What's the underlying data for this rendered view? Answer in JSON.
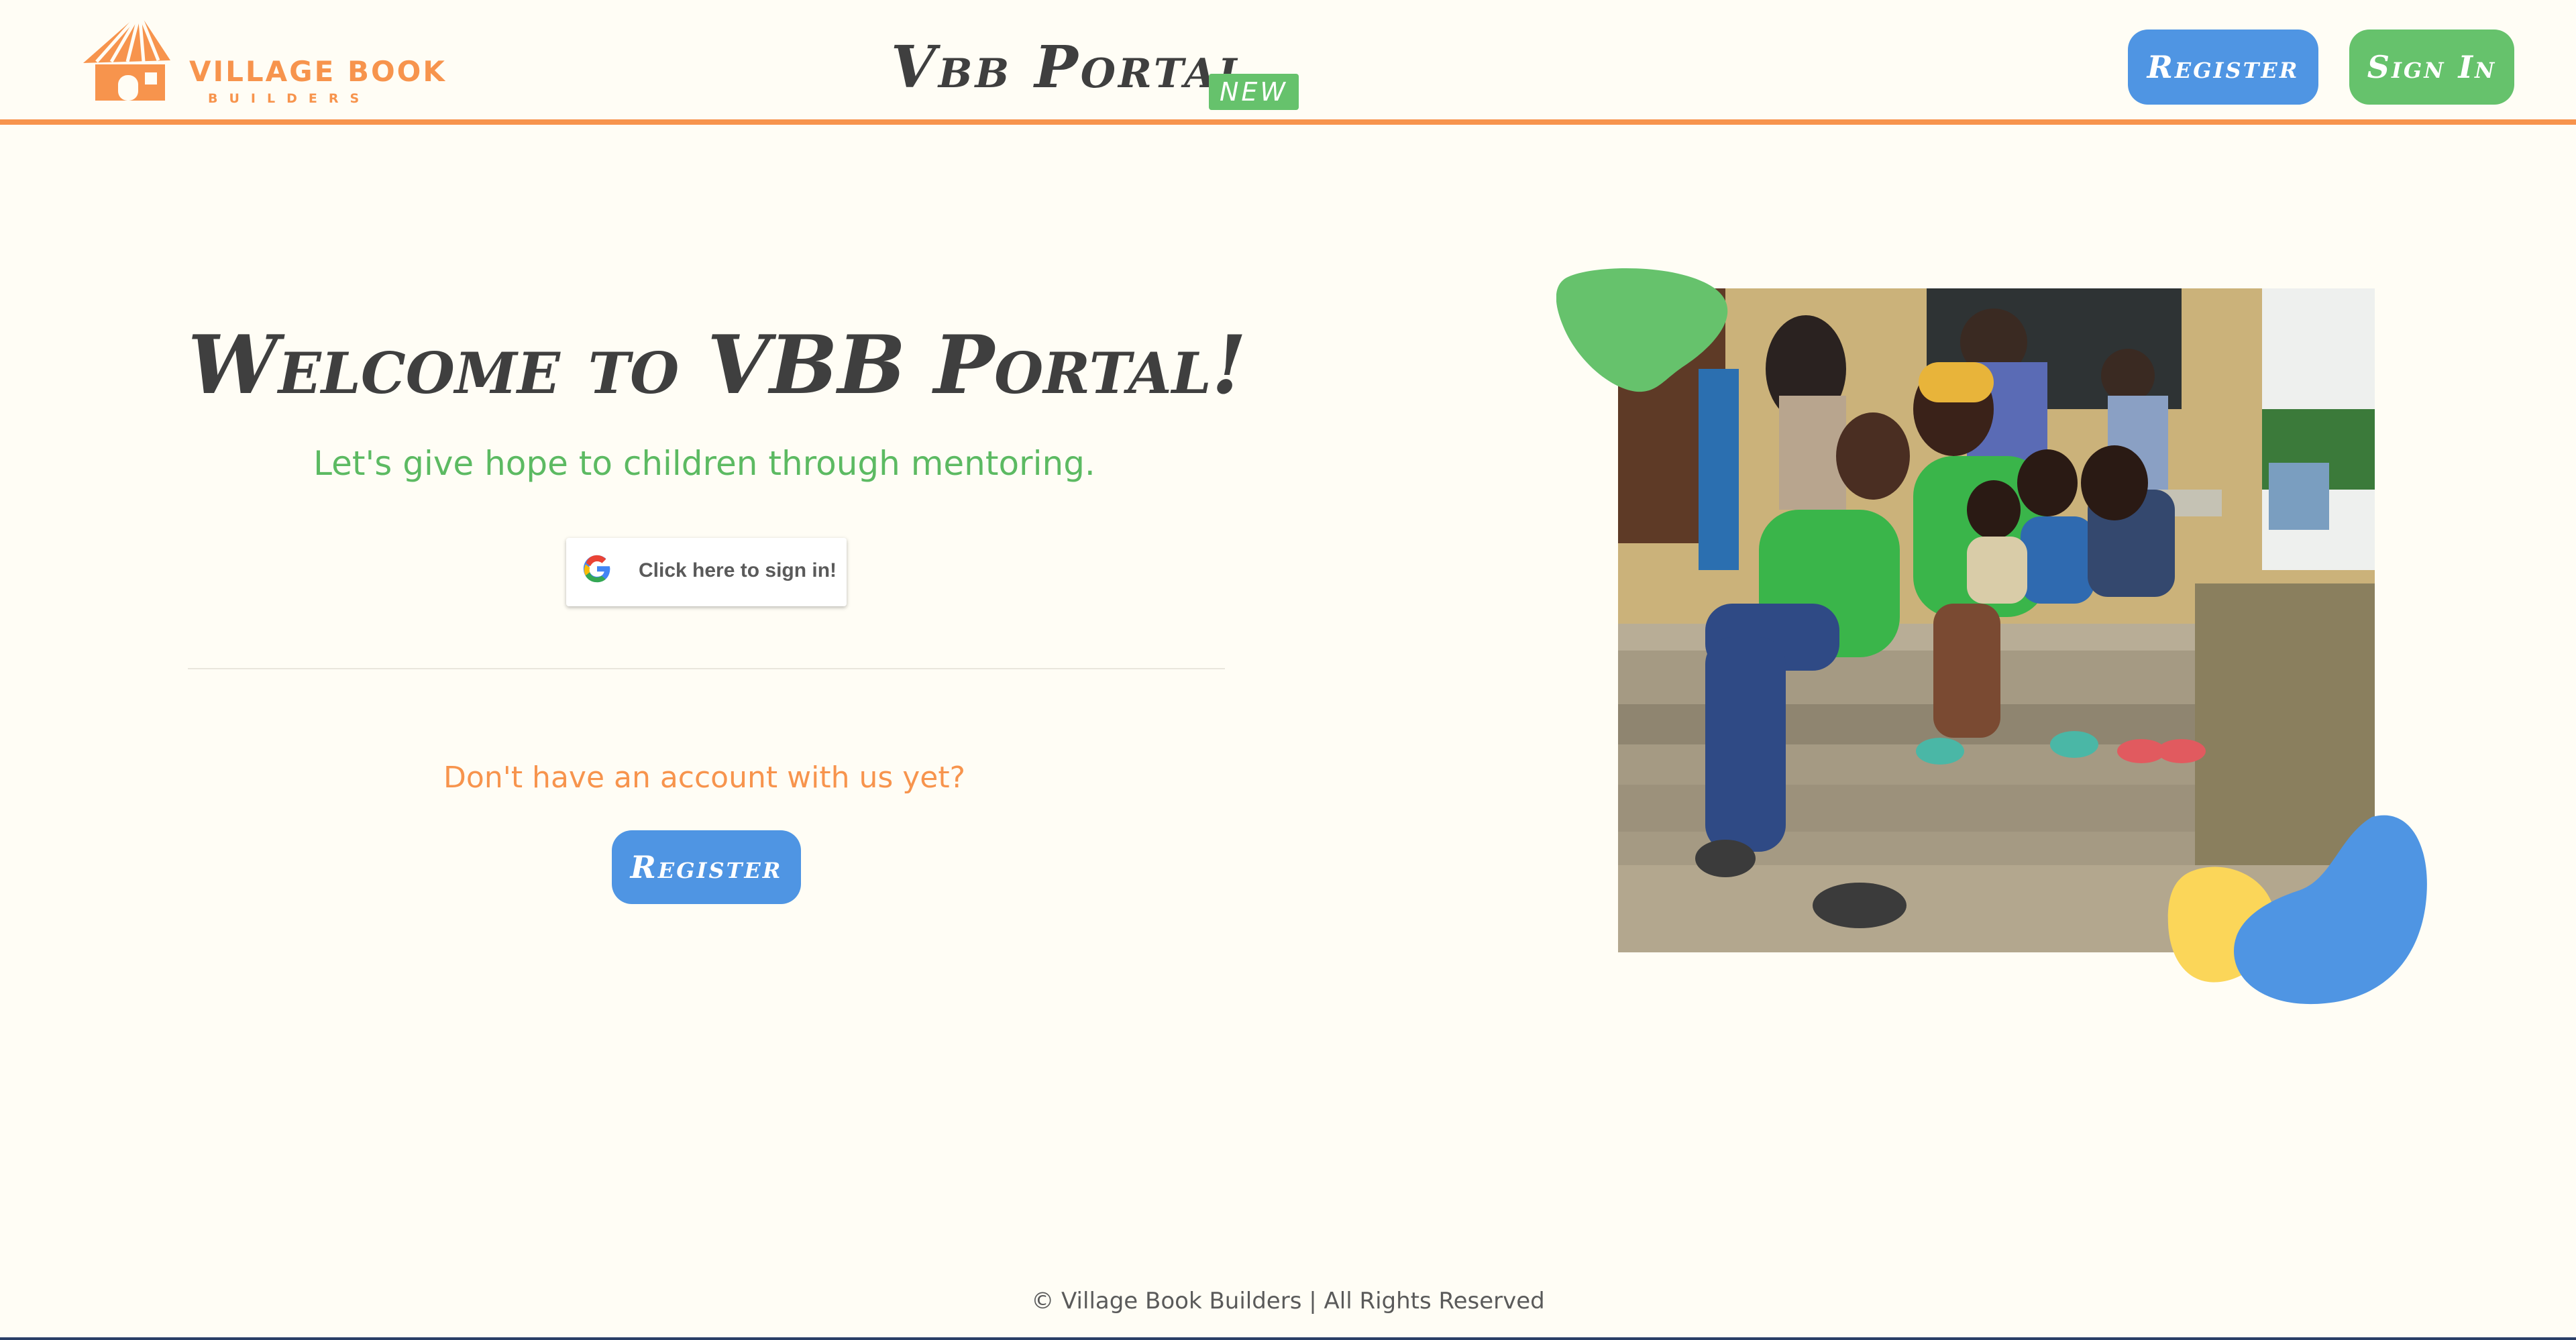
{
  "header": {
    "logo_line1": "VILLAGE BOOK",
    "logo_line2": "BUILDERS",
    "title": "Vbb Portal",
    "badge": "NEW",
    "register_label": "Register",
    "signin_label": "Sign In"
  },
  "main": {
    "welcome": "Welcome to VBB Portal!",
    "tagline": "Let's give hope to children through mentoring.",
    "google_signin_label": "Click here to sign in!",
    "no_account_text": "Don't have an account with us yet?",
    "register_label": "Register"
  },
  "footer": {
    "text": "© Village Book Builders | All Rights Reserved"
  },
  "colors": {
    "accent_orange": "#f7944d",
    "green": "#66c26c",
    "blue": "#4f95e3",
    "yellow": "#fbd659",
    "background": "#fffdf5"
  },
  "icons": {
    "logo": "hut-logo-icon",
    "google": "google-g-icon"
  }
}
